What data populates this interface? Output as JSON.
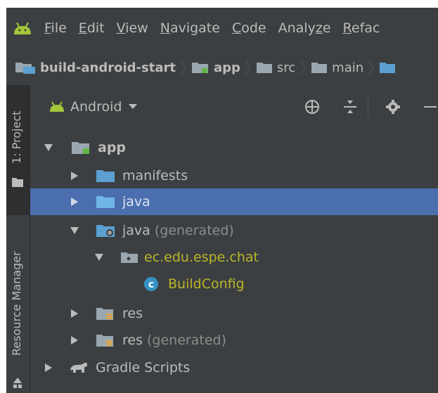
{
  "menubar": {
    "logo_icon": "android-logo-icon",
    "items": [
      {
        "label": "File",
        "mnemonic": "F",
        "rest": "ile"
      },
      {
        "label": "Edit",
        "mnemonic": "E",
        "rest": "dit"
      },
      {
        "label": "View",
        "mnemonic": "V",
        "rest": "iew"
      },
      {
        "label": "Navigate",
        "mnemonic": "N",
        "rest": "avigate"
      },
      {
        "label": "Code",
        "mnemonic": "C",
        "rest": "ode"
      },
      {
        "label": "Analyze",
        "pre": "Analy",
        "mnemonic": "z",
        "rest": "e"
      },
      {
        "label": "Refactor",
        "mnemonic": "R",
        "rest": "efac"
      }
    ]
  },
  "breadcrumb": [
    "build-android-start",
    "app",
    "src",
    "main"
  ],
  "toolstrip": {
    "project_tab": "1: Project",
    "resource_tab": "Resource Manager"
  },
  "panel": {
    "title": "Android",
    "tree": [
      {
        "label": "app",
        "suffix": ""
      },
      {
        "label": "manifests",
        "suffix": ""
      },
      {
        "label": "java",
        "suffix": ""
      },
      {
        "label": "java",
        "suffix": " (generated)"
      },
      {
        "label": "ec.edu.espe.chat",
        "suffix": ""
      },
      {
        "label": "BuildConfig",
        "suffix": ""
      },
      {
        "label": "res",
        "suffix": ""
      },
      {
        "label": "res",
        "suffix": " (generated)"
      },
      {
        "label": "Gradle Scripts",
        "suffix": ""
      }
    ]
  },
  "colors": {
    "background": "#3c3f41",
    "selection": "#4b6eaf",
    "text": "#bbbbbb",
    "generated": "#bbb529",
    "android_green": "#a4c639",
    "folder_blue": "#5ba0d0"
  }
}
